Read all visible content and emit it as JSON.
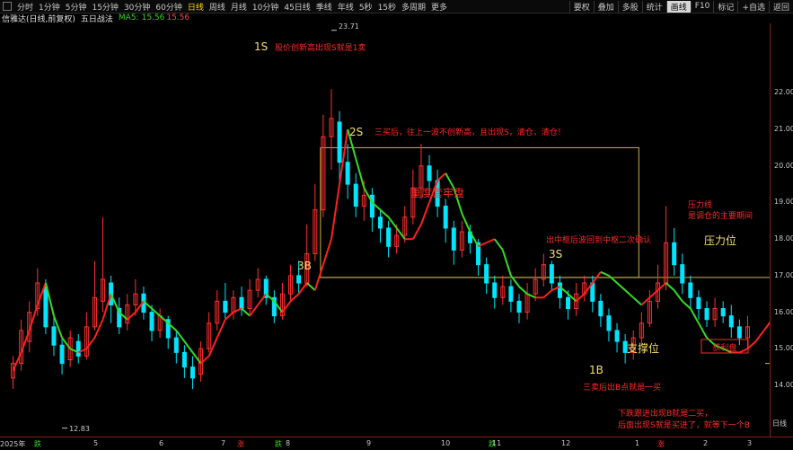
{
  "toolbar": {
    "tabs": [
      "分时",
      "1分钟",
      "5分钟",
      "15分钟",
      "30分钟",
      "60分钟",
      "日线",
      "周线",
      "月线",
      "10分钟",
      "45日线",
      "季线",
      "年线",
      "5秒",
      "15秒",
      "多周期",
      "更多"
    ],
    "active_tab": "日线",
    "right_tools": [
      "要权",
      "叠加",
      "多股",
      "统计",
      "画线",
      "F10",
      "标记",
      "+自选",
      "返回"
    ],
    "highlight_tool": "画线"
  },
  "info": {
    "stock": "信雅达(日线,前复权)",
    "plan": "五日战法",
    "ma_label": "MA5:",
    "ma_value": "15.56",
    "ma_value2": "15.56"
  },
  "yaxis": {
    "ticks": [
      "22.00",
      "21.00",
      "20.00",
      "19.00",
      "18.00",
      "17.00",
      "16.00",
      "15.00",
      "14.00"
    ],
    "side_label": "日线"
  },
  "xaxis": {
    "labels": [
      "2025年",
      "5",
      "6",
      "7",
      "8",
      "9",
      "10",
      "11",
      "12",
      "1",
      "2",
      "3"
    ],
    "marks": [
      "跌",
      "涨",
      "跌",
      "跌",
      "涨"
    ]
  },
  "price_labels": {
    "high": "23.71",
    "low": "12.83"
  },
  "annotations": {
    "s1": "1S",
    "s1_text": "股价创新高出现S就是1卖",
    "s2": "2S",
    "s2_text": "三买后，往上一波不创新高，且出现S，清仓，清仓！",
    "box_text": "重度套牢盘",
    "b3": "3B",
    "s3": "3S",
    "s3_text": "出中枢后波回到中枢二次确认",
    "resist": "压力位",
    "resist_text1": "压力线",
    "resist_text2": "是调仓的主要期间",
    "support": "支撑位",
    "b1": "1B",
    "b1_text": "三卖后出B点就是一买",
    "bottom_text1": "下跌跟进出现B就是二买，",
    "bottom_text2": "后面出现S就是买进了，就等下一个B",
    "profit": "获利盘"
  },
  "colors": {
    "up": "#ff3030",
    "down": "#00e5ff",
    "ma_up": "#ff2020",
    "ma_down": "#33dd22",
    "box": "#c8b44a",
    "anno_red": "#ff2a2a",
    "anno_yellow": "#f2e06c"
  },
  "chart_data": {
    "type": "candlestick",
    "ylim": [
      12.6,
      23.9
    ],
    "note_ma": "MA5",
    "ma5": [
      14.4,
      14.9,
      15.5,
      16.2,
      16.8,
      15.9,
      15.3,
      15.0,
      14.9,
      15.0,
      15.3,
      15.8,
      16.5,
      16.0,
      15.8,
      16.0,
      16.3,
      16.1,
      15.9,
      15.7,
      15.5,
      15.2,
      14.9,
      14.6,
      14.8,
      15.3,
      15.8,
      16.0,
      16.1,
      15.9,
      16.2,
      16.5,
      16.3,
      16.0,
      16.3,
      16.5,
      16.8,
      16.6,
      17.3,
      18.0,
      19.5,
      21.0,
      20.2,
      19.4,
      19.0,
      18.8,
      18.6,
      18.3,
      18.0,
      18.0,
      18.4,
      19.0,
      19.6,
      19.8,
      19.4,
      18.7,
      18.2,
      17.8,
      17.9,
      18.0,
      17.7,
      17.0,
      16.7,
      16.5,
      16.4,
      16.4,
      16.6,
      16.7,
      16.5,
      16.3,
      16.5,
      16.8,
      17.1,
      17.0,
      16.8,
      16.6,
      16.4,
      16.2,
      16.4,
      16.6,
      16.8,
      16.6,
      16.3,
      16.1,
      15.7,
      15.3,
      15.1,
      15.0,
      14.9,
      14.9,
      15.0,
      15.2,
      15.5,
      15.8,
      16.0,
      16.5,
      17.2,
      17.5,
      17.1,
      16.7,
      16.4,
      16.2,
      16.0,
      15.9,
      15.8,
      15.9,
      16.0,
      15.8,
      15.6
    ],
    "candles": [
      [
        14.2,
        14.6,
        13.9,
        14.8
      ],
      [
        14.6,
        15.5,
        14.4,
        15.8
      ],
      [
        15.2,
        16.0,
        14.9,
        16.3
      ],
      [
        16.1,
        16.8,
        15.9,
        17.2
      ],
      [
        16.7,
        15.6,
        15.4,
        16.9
      ],
      [
        15.6,
        15.1,
        14.8,
        15.9
      ],
      [
        15.1,
        14.6,
        14.3,
        15.3
      ],
      [
        14.7,
        15.3,
        14.5,
        15.5
      ],
      [
        15.2,
        14.8,
        14.6,
        15.4
      ],
      [
        14.8,
        15.6,
        14.7,
        16.0
      ],
      [
        15.6,
        16.4,
        15.5,
        17.4
      ],
      [
        16.3,
        16.9,
        16.0,
        18.6
      ],
      [
        16.8,
        16.2,
        15.7,
        17.0
      ],
      [
        16.1,
        15.6,
        15.4,
        16.4
      ],
      [
        15.7,
        16.2,
        15.5,
        16.5
      ],
      [
        16.2,
        16.5,
        15.9,
        16.9
      ],
      [
        16.5,
        16.0,
        15.8,
        16.7
      ],
      [
        16.0,
        15.5,
        15.2,
        16.2
      ],
      [
        15.5,
        15.9,
        15.3,
        16.1
      ],
      [
        15.8,
        15.3,
        15.0,
        15.9
      ],
      [
        15.3,
        14.9,
        14.6,
        15.5
      ],
      [
        14.9,
        14.5,
        14.2,
        15.1
      ],
      [
        14.5,
        14.2,
        13.9,
        14.8
      ],
      [
        14.3,
        15.0,
        14.1,
        15.2
      ],
      [
        15.0,
        15.7,
        14.9,
        16.0
      ],
      [
        15.7,
        16.3,
        15.5,
        16.6
      ],
      [
        16.3,
        16.0,
        15.8,
        16.8
      ],
      [
        16.0,
        16.4,
        15.8,
        16.6
      ],
      [
        16.4,
        16.1,
        15.9,
        16.7
      ],
      [
        16.1,
        16.6,
        15.9,
        16.9
      ],
      [
        16.6,
        16.9,
        16.4,
        17.2
      ],
      [
        16.9,
        16.4,
        16.2,
        17.0
      ],
      [
        16.4,
        15.9,
        15.7,
        16.6
      ],
      [
        15.9,
        16.5,
        15.8,
        16.8
      ],
      [
        16.5,
        17.0,
        16.3,
        17.3
      ],
      [
        17.0,
        16.8,
        16.5,
        17.4
      ],
      [
        16.8,
        17.6,
        16.7,
        18.4
      ],
      [
        17.6,
        18.8,
        17.4,
        19.5
      ],
      [
        18.8,
        20.8,
        18.6,
        21.4
      ],
      [
        20.8,
        21.3,
        19.9,
        22.1
      ],
      [
        21.2,
        20.1,
        19.6,
        21.5
      ],
      [
        20.1,
        19.5,
        19.1,
        20.6
      ],
      [
        19.5,
        18.9,
        18.6,
        19.8
      ],
      [
        18.9,
        19.2,
        18.5,
        19.6
      ],
      [
        19.2,
        18.6,
        18.2,
        19.4
      ],
      [
        18.6,
        18.3,
        17.9,
        18.8
      ],
      [
        18.3,
        17.8,
        17.5,
        18.5
      ],
      [
        17.8,
        18.1,
        17.6,
        18.4
      ],
      [
        18.1,
        18.6,
        17.9,
        18.9
      ],
      [
        18.6,
        19.4,
        18.4,
        19.9
      ],
      [
        19.4,
        20.0,
        19.1,
        20.6
      ],
      [
        20.0,
        19.6,
        19.2,
        20.3
      ],
      [
        19.6,
        18.9,
        18.6,
        19.9
      ],
      [
        18.9,
        18.3,
        17.9,
        19.1
      ],
      [
        18.3,
        17.7,
        17.3,
        18.5
      ],
      [
        17.7,
        18.2,
        17.5,
        18.5
      ],
      [
        18.2,
        17.9,
        17.6,
        18.4
      ],
      [
        17.9,
        17.3,
        17.0,
        18.0
      ],
      [
        17.3,
        16.8,
        16.5,
        17.5
      ],
      [
        16.8,
        16.4,
        16.1,
        17.0
      ],
      [
        16.4,
        16.7,
        16.2,
        17.0
      ],
      [
        16.7,
        16.3,
        16.0,
        16.9
      ],
      [
        16.3,
        16.0,
        15.7,
        16.5
      ],
      [
        16.0,
        16.5,
        15.8,
        16.8
      ],
      [
        16.5,
        16.9,
        16.3,
        17.2
      ],
      [
        16.9,
        17.3,
        16.7,
        17.6
      ],
      [
        17.3,
        16.8,
        16.6,
        17.4
      ],
      [
        16.8,
        16.4,
        16.1,
        17.0
      ],
      [
        16.4,
        16.1,
        15.8,
        16.6
      ],
      [
        16.1,
        16.5,
        15.9,
        16.8
      ],
      [
        16.5,
        16.8,
        16.3,
        17.0
      ],
      [
        16.8,
        16.3,
        16.0,
        17.0
      ],
      [
        16.3,
        15.9,
        15.6,
        16.5
      ],
      [
        15.9,
        15.5,
        15.2,
        16.1
      ],
      [
        15.5,
        15.2,
        14.9,
        15.7
      ],
      [
        15.2,
        14.9,
        14.6,
        15.4
      ],
      [
        14.9,
        15.3,
        14.7,
        15.5
      ],
      [
        15.3,
        15.7,
        15.1,
        16.0
      ],
      [
        15.7,
        16.3,
        15.6,
        16.6
      ],
      [
        16.3,
        16.8,
        16.1,
        17.3
      ],
      [
        16.8,
        17.9,
        16.6,
        18.9
      ],
      [
        17.9,
        17.3,
        17.0,
        18.3
      ],
      [
        17.3,
        16.8,
        16.5,
        17.6
      ],
      [
        16.8,
        16.4,
        16.1,
        17.0
      ],
      [
        16.4,
        16.1,
        15.8,
        16.6
      ],
      [
        16.1,
        15.8,
        15.6,
        16.3
      ],
      [
        15.8,
        16.1,
        15.6,
        16.4
      ],
      [
        16.1,
        15.9,
        15.7,
        16.3
      ],
      [
        15.9,
        15.6,
        15.3,
        16.2
      ],
      [
        15.6,
        15.3,
        15.1,
        15.8
      ],
      [
        15.3,
        15.6,
        15.0,
        15.9
      ]
    ]
  }
}
